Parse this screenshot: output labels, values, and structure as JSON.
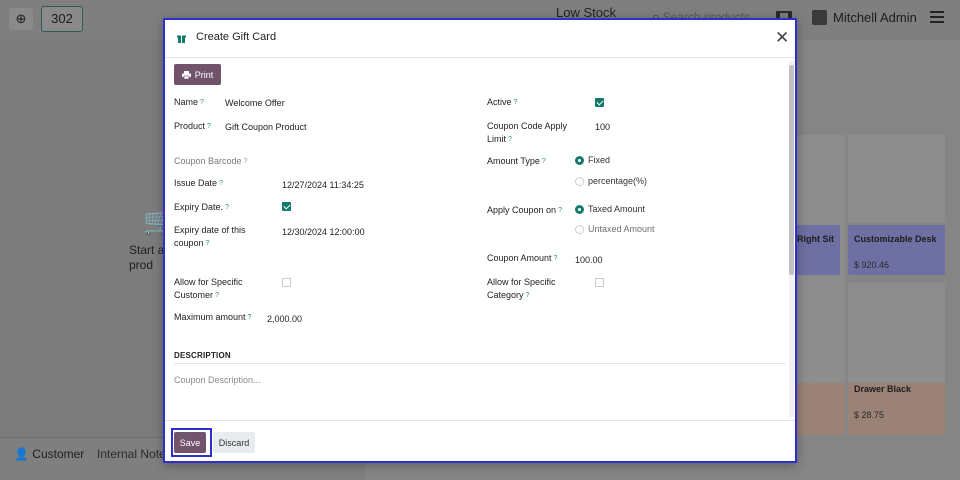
{
  "background": {
    "order_number": "302",
    "low_stock_label": "Low Stock",
    "search_placeholder": "Search products...",
    "user_name": "Mitchell Admin",
    "start_message_line1": "Start a",
    "start_message_line2": "prod",
    "customer_label": "Customer",
    "internal_note_label": "Internal Note",
    "products": [
      {
        "name": "Right Sit",
        "price": ""
      },
      {
        "name": "Customizable Desk",
        "price": "$ 920.46"
      },
      {
        "name": "Drawer Black",
        "price": "$ 28.75"
      }
    ]
  },
  "dialog": {
    "title": "Create Gift Card",
    "print_label": "Print",
    "left": {
      "name_label": "Name",
      "name_value": "Welcome Offer",
      "product_label": "Product",
      "product_value": "Gift Coupon Product",
      "barcode_label": "Coupon Barcode",
      "issue_date_label": "Issue Date",
      "issue_date_value": "12/27/2024 11:34:25",
      "expiry_label": "Expiry Date.",
      "expiry_checked": true,
      "expiry_coupon_label_1": "Expiry date of this",
      "expiry_coupon_label_2": "coupon",
      "expiry_coupon_value": "12/30/2024 12:00:00",
      "specific_customer_label_1": "Allow for Specific",
      "specific_customer_label_2": "Customer",
      "specific_customer_checked": false,
      "max_amount_label": "Maximum amount",
      "max_amount_value": "2,000.00"
    },
    "right": {
      "active_label": "Active",
      "active_checked": true,
      "apply_limit_label_1": "Coupon Code Apply",
      "apply_limit_label_2": "Limit",
      "apply_limit_value": "100",
      "amount_type_label": "Amount Type",
      "amount_type_options": [
        "Fixed",
        "percentage(%)"
      ],
      "amount_type_selected": "Fixed",
      "apply_on_label": "Apply Coupon on",
      "apply_on_options": [
        "Taxed Amount",
        "Untaxed Amount"
      ],
      "apply_on_selected": "Taxed Amount",
      "coupon_amount_label": "Coupon Amount",
      "coupon_amount_value": "100.00",
      "specific_category_label_1": "Allow for Specific",
      "specific_category_label_2": "Category",
      "specific_category_checked": false
    },
    "description_heading": "DESCRIPTION",
    "description_placeholder": "Coupon Description...",
    "save_label": "Save",
    "discard_label": "Discard"
  },
  "colors": {
    "primary": "#71536c",
    "accent_teal": "#157a6e",
    "focus_outline": "#2f2fcf"
  }
}
